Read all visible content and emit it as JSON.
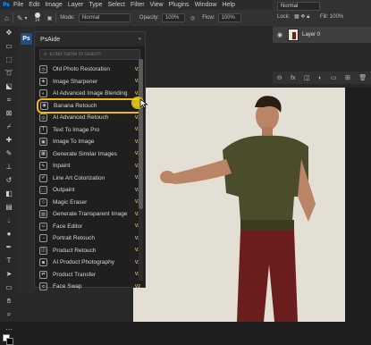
{
  "menubar": {
    "logo": "Ps",
    "items": [
      "File",
      "Edit",
      "Image",
      "Layer",
      "Type",
      "Select",
      "Filter",
      "View",
      "Plugins",
      "Window",
      "Help"
    ]
  },
  "options": {
    "brush_size": "14",
    "mode_label": "Mode:",
    "mode_value": "Normal",
    "opacity_label": "Opacity:",
    "opacity_value": "100%",
    "flow_label": "Flow:",
    "flow_value": "100%"
  },
  "layers": {
    "blend_mode": "Normal",
    "lock_label": "Lock:",
    "fill_label": "Fill:",
    "fill_value": "100%",
    "layer_name": "Layer 0"
  },
  "plugin_panel": {
    "title": "PsAide",
    "search_placeholder": "Enter name to search",
    "items": [
      {
        "label": "Old Photo Restoration",
        "version": "V2"
      },
      {
        "label": "Image Sharpener",
        "version": "V2"
      },
      {
        "label": "AI Advanced Image Blending",
        "version": "V2"
      },
      {
        "label": "Banana Retouch",
        "version": "V2"
      },
      {
        "label": "AI Advanced Retouch",
        "version": "V2"
      },
      {
        "label": "Text To Image Pro",
        "version": "V2"
      },
      {
        "label": "Image To Image",
        "version": "V2"
      },
      {
        "label": "Generate Similar Images",
        "version": "V2"
      },
      {
        "label": "Inpaint",
        "version": "V2"
      },
      {
        "label": "Line Art Colorization",
        "version": "V2"
      },
      {
        "label": "Outpaint",
        "version": "V2"
      },
      {
        "label": "Magic Eraser",
        "version": "V2"
      },
      {
        "label": "Generate Transparent Image",
        "version": "V2"
      },
      {
        "label": "Face Editor",
        "version": "V2"
      },
      {
        "label": "Portrait Retouch",
        "version": "V2"
      },
      {
        "label": "Product Retouch",
        "version": "V2"
      },
      {
        "label": "AI Product Photography",
        "version": "V2"
      },
      {
        "label": "Product Transfer",
        "version": "V2"
      },
      {
        "label": "Face Swap",
        "version": "V2"
      }
    ],
    "highlighted_index": 3
  },
  "colors": {
    "highlight": "#f2b90f",
    "version_badge": "#e9b44c",
    "shirt": "#4b4c2c",
    "pants": "#6a1e1e",
    "backdrop": "#e4dfd5"
  }
}
